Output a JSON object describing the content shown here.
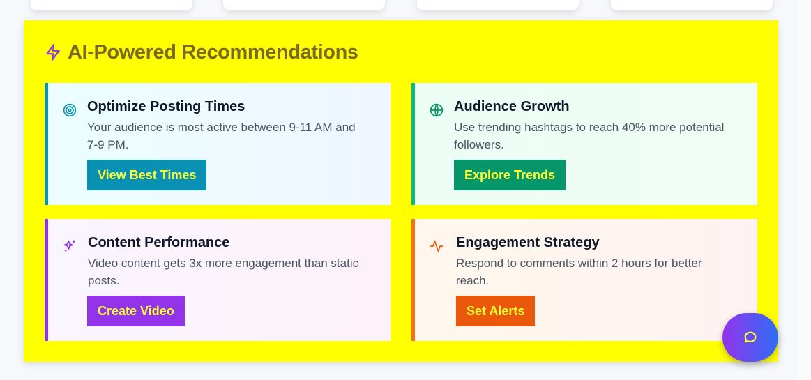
{
  "header": {
    "title": "AI-Powered Recommendations",
    "icon": "lightning-icon"
  },
  "cards": [
    {
      "title": "Optimize Posting Times",
      "description": "Your audience is most active between 9-11 AM and 7-9 PM.",
      "button": "View Best Times",
      "icon": "target-icon",
      "accent": "#0891b2"
    },
    {
      "title": "Audience Growth",
      "description": "Use trending hashtags to reach 40% more potential followers.",
      "button": "Explore Trends",
      "icon": "globe-icon",
      "accent": "#10b981"
    },
    {
      "title": "Content Performance",
      "description": "Video content gets 3x more engagement than static posts.",
      "button": "Create Video",
      "icon": "sparkles-icon",
      "accent": "#9333ea"
    },
    {
      "title": "Engagement Strategy",
      "description": "Respond to comments within 2 hours for better reach.",
      "button": "Set Alerts",
      "icon": "activity-icon",
      "accent": "#f97316"
    }
  ],
  "fab": {
    "icon": "chat-bubble-icon"
  },
  "colors": {
    "panel_bg": "#ffff00",
    "title": "#7a6824",
    "button_text": "#ffff33",
    "btn_cyan": "#0891b2",
    "btn_green": "#059669",
    "btn_purple": "#9333ea",
    "btn_orange": "#ea580c"
  }
}
